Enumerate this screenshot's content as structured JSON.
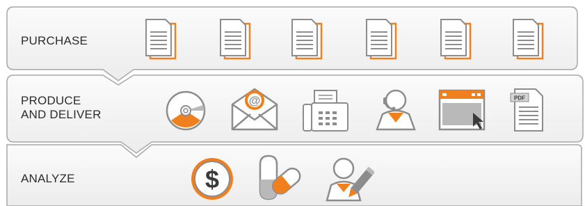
{
  "bands": [
    {
      "label": "PURCHASE",
      "icon_count": 6,
      "icon_names": [
        "document-stack-icon"
      ]
    },
    {
      "label": "PRODUCE AND DELIVER",
      "label_lines": [
        "PRODUCE",
        "AND DELIVER"
      ],
      "icon_names": [
        "cd-disc-icon",
        "email-envelope-icon",
        "fax-machine-icon",
        "call-center-agent-icon",
        "browser-window-icon",
        "pdf-document-icon"
      ]
    },
    {
      "label": "ANALYZE",
      "icon_names": [
        "dollar-coin-icon",
        "pill-capsule-icon",
        "user-edit-icon"
      ]
    }
  ],
  "icon_text": {
    "email": "@",
    "dollar": "$",
    "pdf": "PDF"
  },
  "colors": {
    "accent": "#f07f1e",
    "icon_gray": "#8c8c8c",
    "band_border": "#a7a7a7",
    "band_fill": "#f4f4f4",
    "text": "#2b2b2b"
  }
}
